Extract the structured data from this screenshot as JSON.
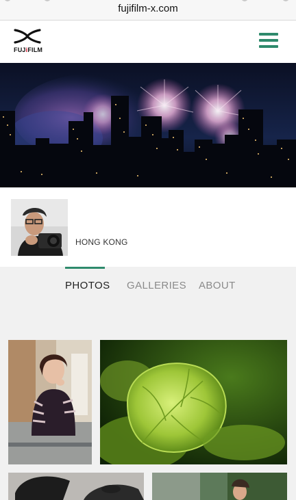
{
  "browser": {
    "url": "fujifilm-x.com"
  },
  "header": {
    "logo_text_pre": "FUJ",
    "logo_text_i": "i",
    "logo_text_post": "FILM",
    "menu_icon": "hamburger-menu-icon"
  },
  "profile": {
    "location": "HONG KONG"
  },
  "tabs": [
    {
      "label": "PHOTOS",
      "active": true
    },
    {
      "label": "GALLERIES",
      "active": false
    },
    {
      "label": "ABOUT",
      "active": false
    }
  ],
  "colors": {
    "accent": "#2e8a6c",
    "page_background": "#f1f1f1",
    "logo_red": "#d50f25"
  }
}
